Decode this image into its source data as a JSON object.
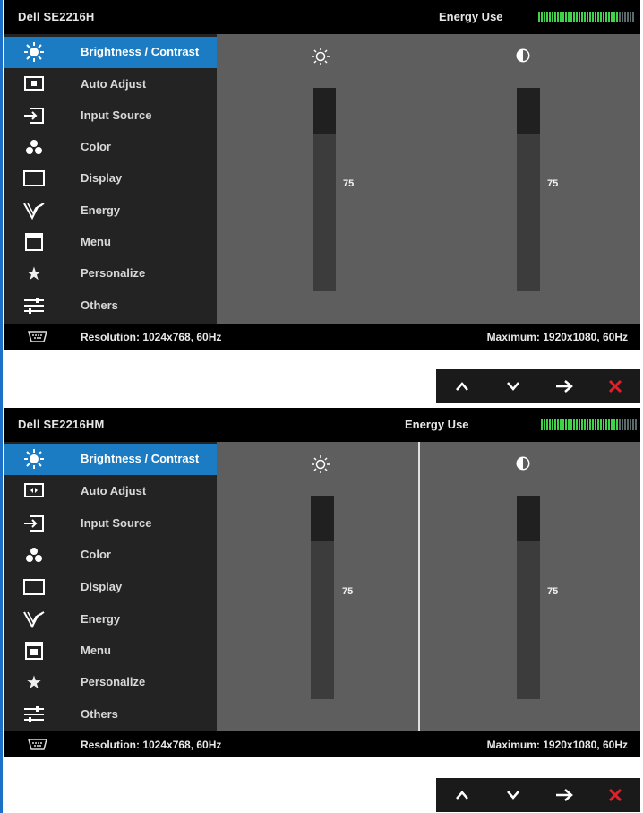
{
  "colors": {
    "accent": "#1b7cc3",
    "exit_x": "#e0202a",
    "energy_green": "#3fd34a",
    "energy_gray": "#5a6a6a"
  },
  "icon_names": [
    "sun-icon",
    "contrast-icon",
    "auto-adjust-icon",
    "input-source-icon",
    "color-icon",
    "display-icon",
    "energy-icon",
    "menu-icon",
    "star-icon",
    "others-icon",
    "up-arrow-icon",
    "down-arrow-icon",
    "right-arrow-icon",
    "close-icon"
  ],
  "osd_top": {
    "model": "Dell SE2216H",
    "energy_label": "Energy Use",
    "energy_level": 0.83,
    "menu": [
      {
        "label": "Brightness / Contrast",
        "icon": "sun-icon",
        "active": true
      },
      {
        "label": "Auto Adjust",
        "icon": "auto-adjust-icon"
      },
      {
        "label": "Input Source",
        "icon": "input-source-icon"
      },
      {
        "label": "Color",
        "icon": "color-icon"
      },
      {
        "label": "Display",
        "icon": "display-icon"
      },
      {
        "label": "Energy",
        "icon": "energy-icon"
      },
      {
        "label": "Menu",
        "icon": "menu-icon"
      },
      {
        "label": "Personalize",
        "icon": "star-icon"
      },
      {
        "label": "Others",
        "icon": "others-icon"
      }
    ],
    "brightness": {
      "value": "75",
      "level": 0.75
    },
    "contrast": {
      "value": "75",
      "level": 0.75
    },
    "resolution": "Resolution: 1024x768, 60Hz",
    "maximum": "Maximum: 1920x1080, 60Hz"
  },
  "osd_bottom": {
    "model": "Dell SE2216HM",
    "energy_label": "Energy Use",
    "energy_level": 0.8,
    "menu": [
      {
        "label": "Brightness / Contrast",
        "icon": "sun-icon",
        "active": true
      },
      {
        "label": "Auto Adjust",
        "icon": "auto-adjust-icon"
      },
      {
        "label": "Input Source",
        "icon": "input-source-icon"
      },
      {
        "label": "Color",
        "icon": "color-icon"
      },
      {
        "label": "Display",
        "icon": "display-icon"
      },
      {
        "label": "Energy",
        "icon": "energy-icon"
      },
      {
        "label": "Menu",
        "icon": "menu-icon"
      },
      {
        "label": "Personalize",
        "icon": "star-icon"
      },
      {
        "label": "Others",
        "icon": "others-icon"
      }
    ],
    "brightness": {
      "value": "75",
      "level": 0.75
    },
    "contrast": {
      "value": "75",
      "level": 0.75
    },
    "resolution": "Resolution: 1024x768, 60Hz",
    "maximum": "Maximum: 1920x1080, 60Hz"
  },
  "buttons": [
    "up",
    "down",
    "enter",
    "exit"
  ]
}
